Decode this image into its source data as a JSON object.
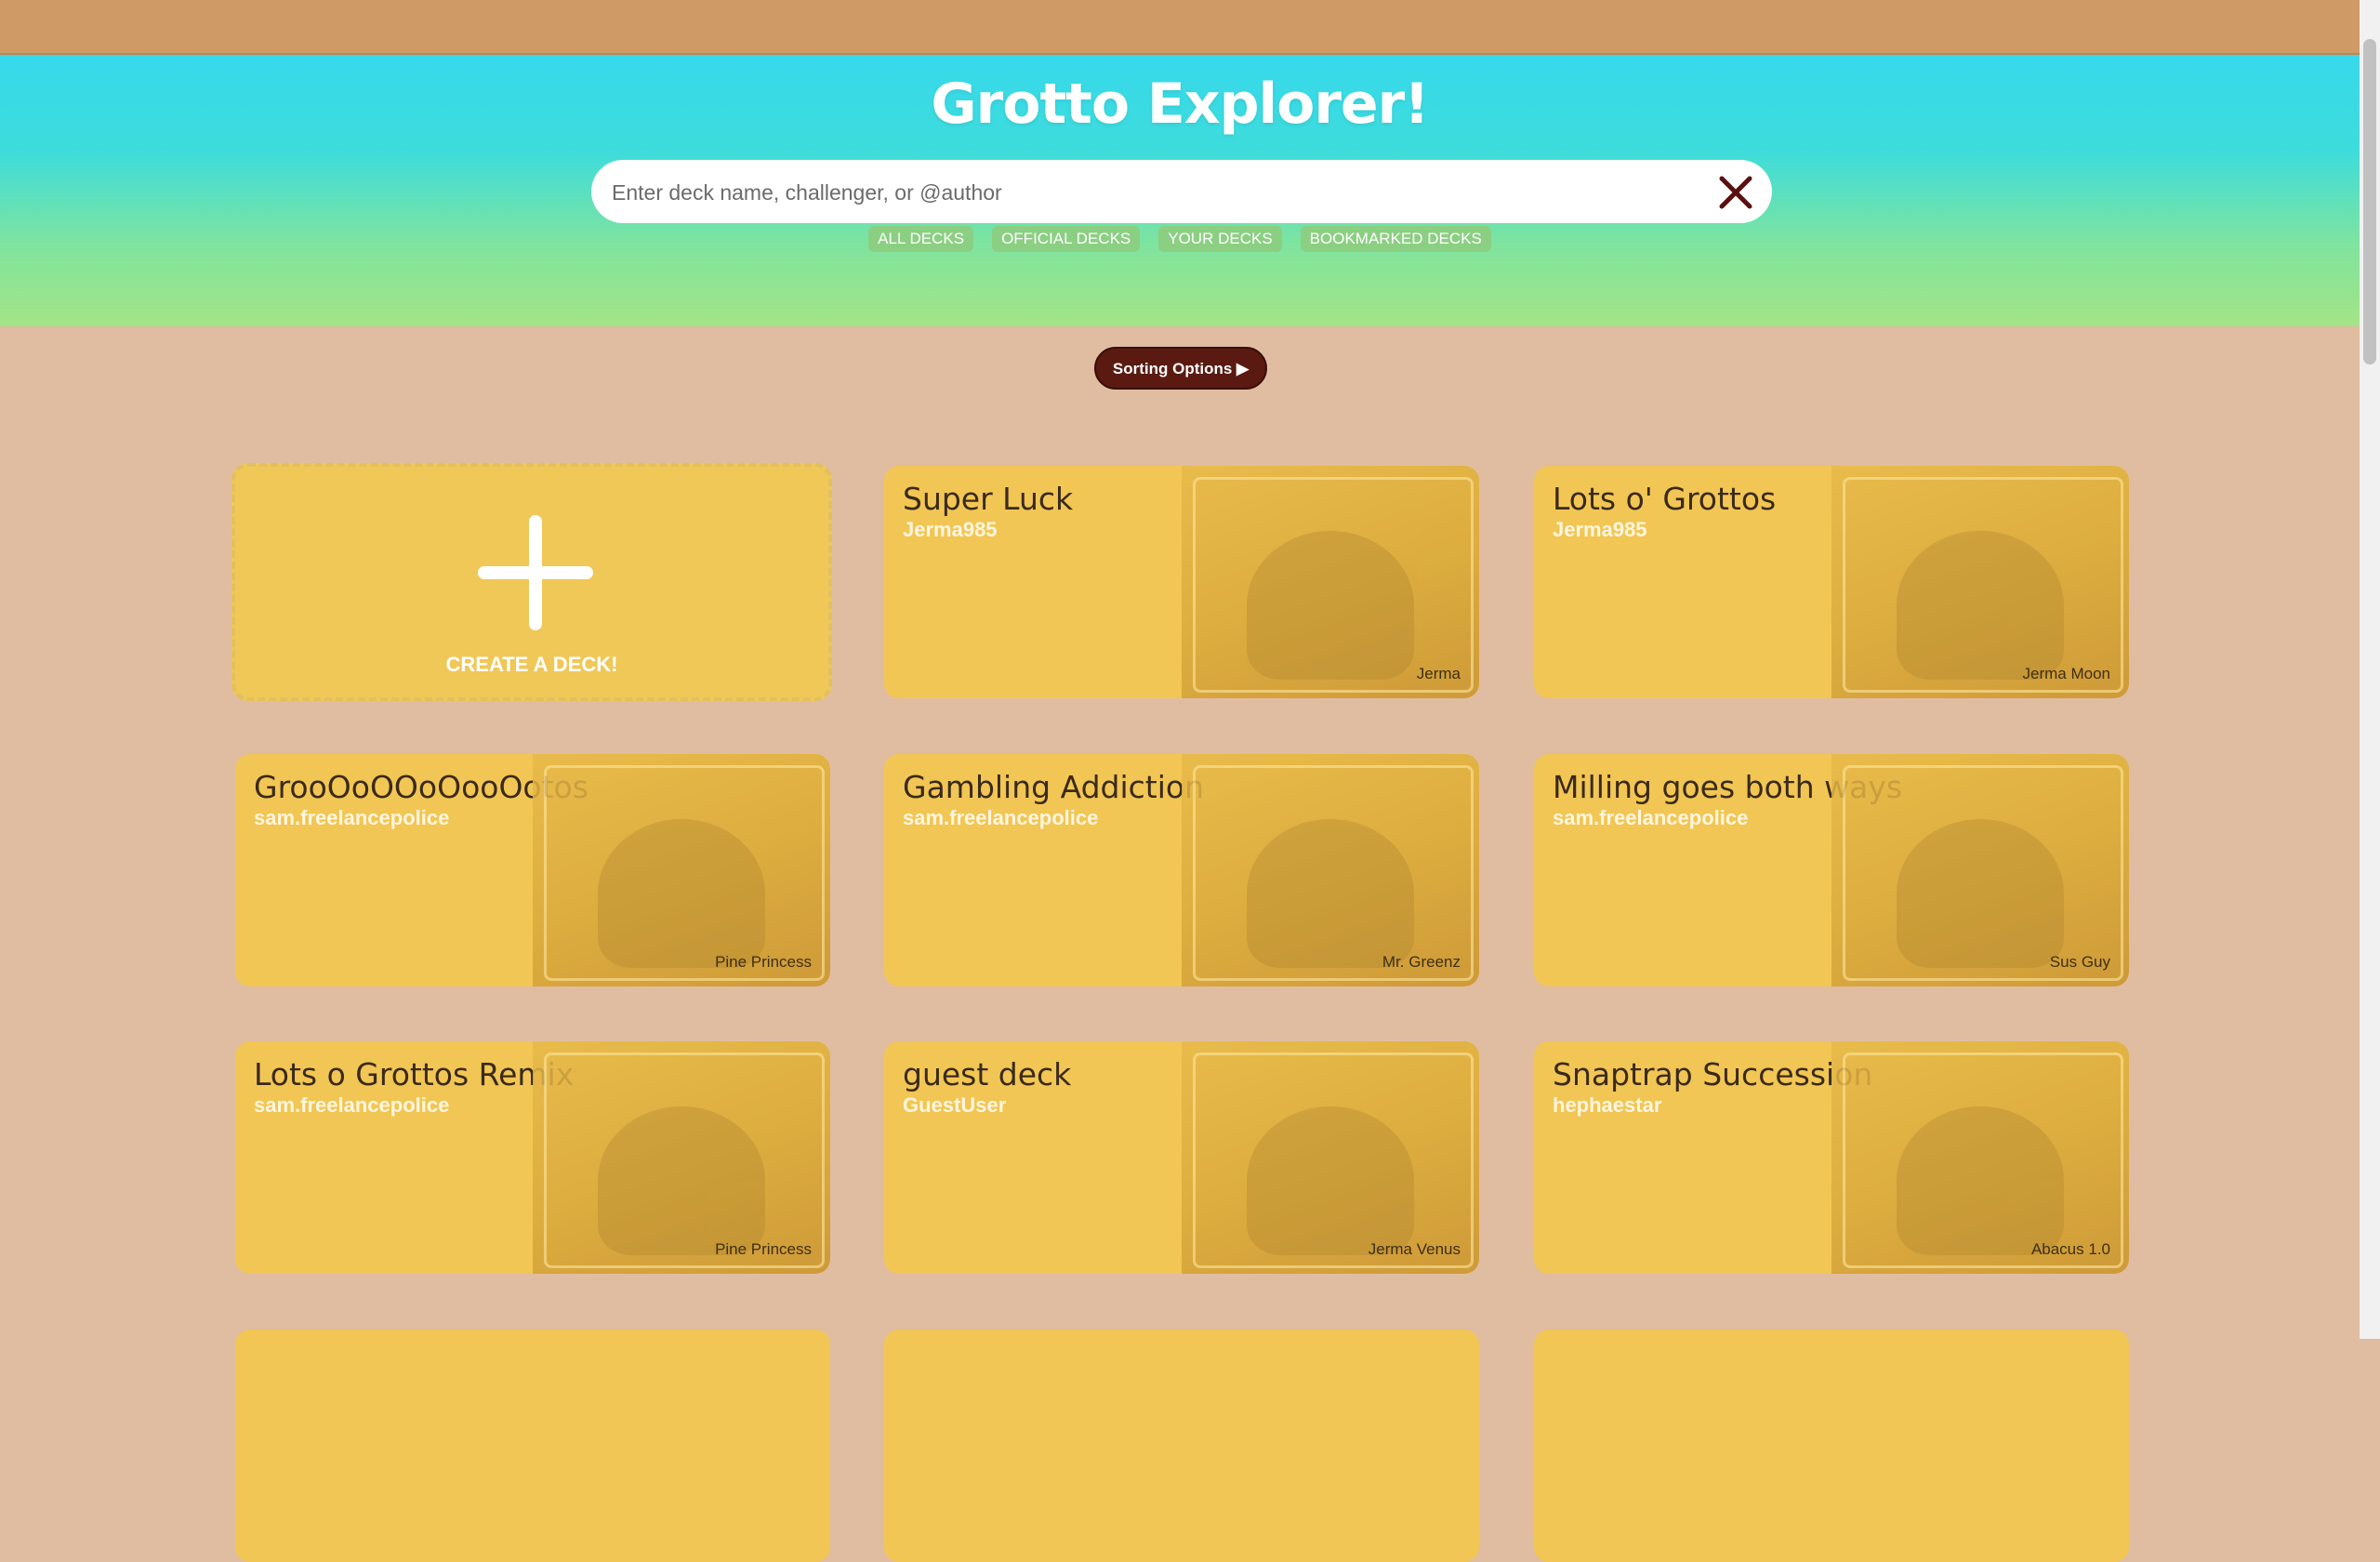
{
  "hero": {
    "title": "Grotto Explorer!",
    "search_placeholder": "Enter deck name, challenger, or @author"
  },
  "filters": [
    "ALL DECKS",
    "OFFICIAL DECKS",
    "YOUR DECKS",
    "BOOKMARKED DECKS"
  ],
  "sort_label": "Sorting Options ▶",
  "create_label": "CREATE A DECK!",
  "decks": [
    {
      "name": "Super Luck",
      "author": "Jerma985",
      "card": "Jerma"
    },
    {
      "name": "Lots o' Grottos",
      "author": "Jerma985",
      "card": "Jerma Moon"
    },
    {
      "name": "GrooOoOOoOooOotos",
      "author": "sam.freelancepolice",
      "card": "Pine Princess"
    },
    {
      "name": "Gambling Addiction",
      "author": "sam.freelancepolice",
      "card": "Mr. Greenz"
    },
    {
      "name": "Milling goes both ways",
      "author": "sam.freelancepolice",
      "card": "Sus Guy"
    },
    {
      "name": "Lots o Grottos Remix",
      "author": "sam.freelancepolice",
      "card": "Pine Princess"
    },
    {
      "name": "guest deck",
      "author": "GuestUser",
      "card": "Jerma Venus"
    },
    {
      "name": "Snaptrap Succession",
      "author": "hephaestar",
      "card": "Abacus 1.0"
    }
  ],
  "colors": {
    "topbar": "#d09a66",
    "background": "#e0bda1",
    "card": "#f2c654",
    "chip": "#8bcf83",
    "sort_button": "#5a1a12"
  }
}
